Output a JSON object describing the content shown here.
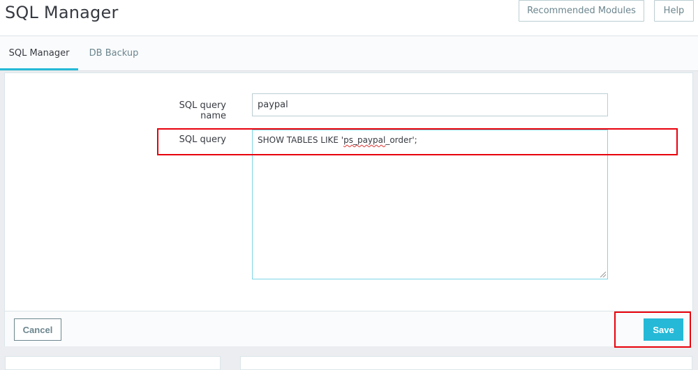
{
  "header": {
    "title": "SQL Manager",
    "recommended_label": "Recommended Modules",
    "help_label": "Help"
  },
  "tabs": [
    {
      "label": "SQL Manager",
      "active": true
    },
    {
      "label": "DB Backup",
      "active": false
    }
  ],
  "form": {
    "name_label": "SQL query name",
    "name_value": "paypal",
    "query_label": "SQL query",
    "query_prefix": "SHOW TABLES LIKE '",
    "query_marked": "ps_paypal",
    "query_suffix": "_order';"
  },
  "footer": {
    "cancel_label": "Cancel",
    "save_label": "Save"
  },
  "colors": {
    "accent": "#25b9d7",
    "highlight": "#e8000b"
  }
}
